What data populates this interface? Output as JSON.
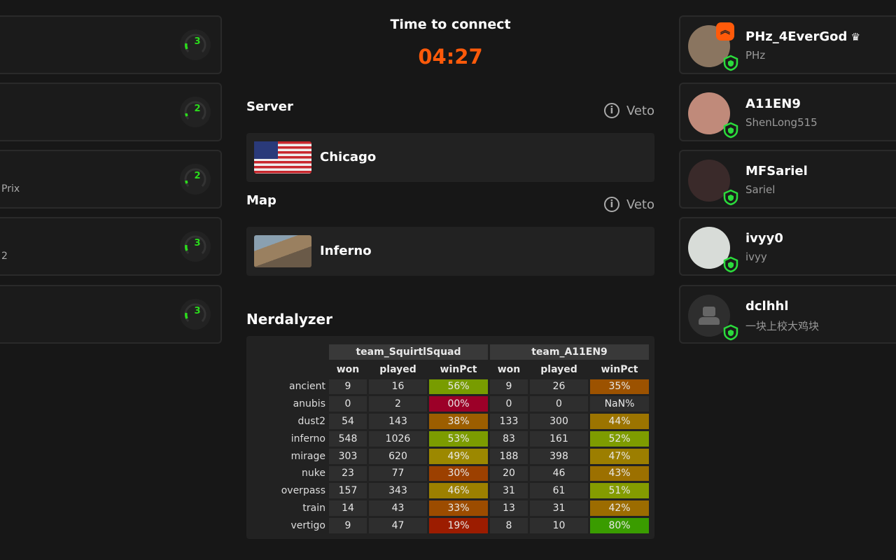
{
  "left_cards": [
    {
      "sub": "",
      "level": "3"
    },
    {
      "sub": "",
      "level": "2"
    },
    {
      "sub": "Prix",
      "level": "2"
    },
    {
      "sub": "2",
      "level": "3"
    },
    {
      "sub": "",
      "level": "3"
    }
  ],
  "header": {
    "title": "Time to connect",
    "countdown": "04:27"
  },
  "server": {
    "label": "Server",
    "veto": "Veto",
    "value": "Chicago"
  },
  "map": {
    "label": "Map",
    "veto": "Veto",
    "value": "Inferno"
  },
  "nerdalyzer": {
    "title": "Nerdalyzer",
    "teams": [
      "team_SquirtlSquad",
      "team_A11EN9"
    ],
    "columns": [
      "won",
      "played",
      "winPct"
    ],
    "rows": [
      {
        "map": "ancient",
        "t1": [
          "9",
          "16",
          "56%"
        ],
        "t2": [
          "9",
          "26",
          "35%"
        ],
        "c1": "#789c00",
        "c2": "#9c5200"
      },
      {
        "map": "anubis",
        "t1": [
          "0",
          "2",
          "00%"
        ],
        "t2": [
          "0",
          "0",
          "NaN%"
        ],
        "c1": "#9c0028",
        "c2": "#2e2e2e"
      },
      {
        "map": "dust2",
        "t1": [
          "54",
          "143",
          "38%"
        ],
        "t2": [
          "133",
          "300",
          "44%"
        ],
        "c1": "#9c5e00",
        "c2": "#9c7400"
      },
      {
        "map": "inferno",
        "t1": [
          "548",
          "1026",
          "53%"
        ],
        "t2": [
          "83",
          "161",
          "52%"
        ],
        "c1": "#7c9c00",
        "c2": "#7e9c00"
      },
      {
        "map": "mirage",
        "t1": [
          "303",
          "620",
          "49%"
        ],
        "t2": [
          "188",
          "398",
          "47%"
        ],
        "c1": "#9c8800",
        "c2": "#9c7e00"
      },
      {
        "map": "nuke",
        "t1": [
          "23",
          "77",
          "30%"
        ],
        "t2": [
          "20",
          "46",
          "43%"
        ],
        "c1": "#9c4000",
        "c2": "#9c7000"
      },
      {
        "map": "overpass",
        "t1": [
          "157",
          "343",
          "46%"
        ],
        "t2": [
          "31",
          "61",
          "51%"
        ],
        "c1": "#9c8000",
        "c2": "#849c00"
      },
      {
        "map": "train",
        "t1": [
          "14",
          "43",
          "33%"
        ],
        "t2": [
          "13",
          "31",
          "42%"
        ],
        "c1": "#9c4c00",
        "c2": "#9c6c00"
      },
      {
        "map": "vertigo",
        "t1": [
          "9",
          "47",
          "19%"
        ],
        "t2": [
          "8",
          "10",
          "80%"
        ],
        "c1": "#9c1c00",
        "c2": "#3a9c00"
      }
    ]
  },
  "players": [
    {
      "name": "PHz_4EverGod",
      "sub": "PHz",
      "leader": true,
      "avatar": "#8a7560"
    },
    {
      "name": "A11EN9",
      "sub": "ShenLong515",
      "leader": false,
      "avatar": "#c08a7a"
    },
    {
      "name": "MFSariel",
      "sub": "Sariel",
      "leader": false,
      "avatar": "#3a2a2a"
    },
    {
      "name": "ivyy0",
      "sub": "ivyy",
      "leader": false,
      "avatar": "#d8dcd8"
    },
    {
      "name": "dclhhl",
      "sub": "一块上校大鸡块",
      "leader": false,
      "avatar": "#2e2e2e"
    }
  ],
  "colors": {
    "accent": "#ff5a0a",
    "level": "#2bdc1c",
    "shield": "#2bdc3c"
  }
}
